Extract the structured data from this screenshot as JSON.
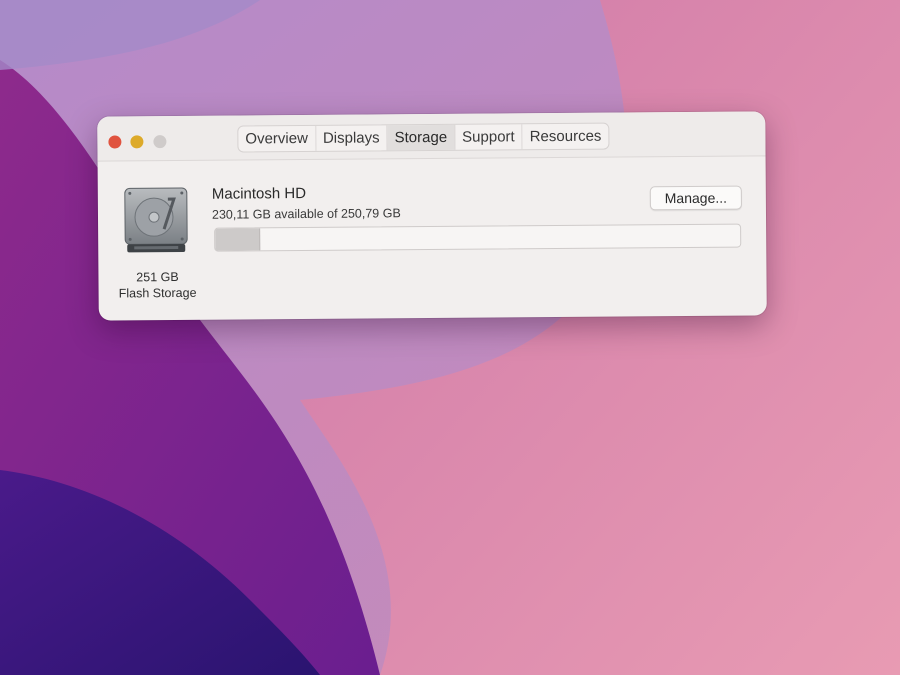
{
  "tabs": [
    {
      "label": "Overview"
    },
    {
      "label": "Displays"
    },
    {
      "label": "Storage",
      "active": true
    },
    {
      "label": "Support"
    },
    {
      "label": "Resources"
    }
  ],
  "disk": {
    "name": "Macintosh HD",
    "available_text": "230,11 GB available of 250,79 GB",
    "capacity_label": "251 GB",
    "type_label": "Flash Storage",
    "used_fraction": 0.083
  },
  "buttons": {
    "manage_label": "Manage..."
  },
  "colors": {
    "close": "#e0533f",
    "minimize": "#ddaa2a",
    "zoom_inactive": "#cfcbca"
  },
  "icons": {
    "disk": "hard-drive-icon"
  }
}
